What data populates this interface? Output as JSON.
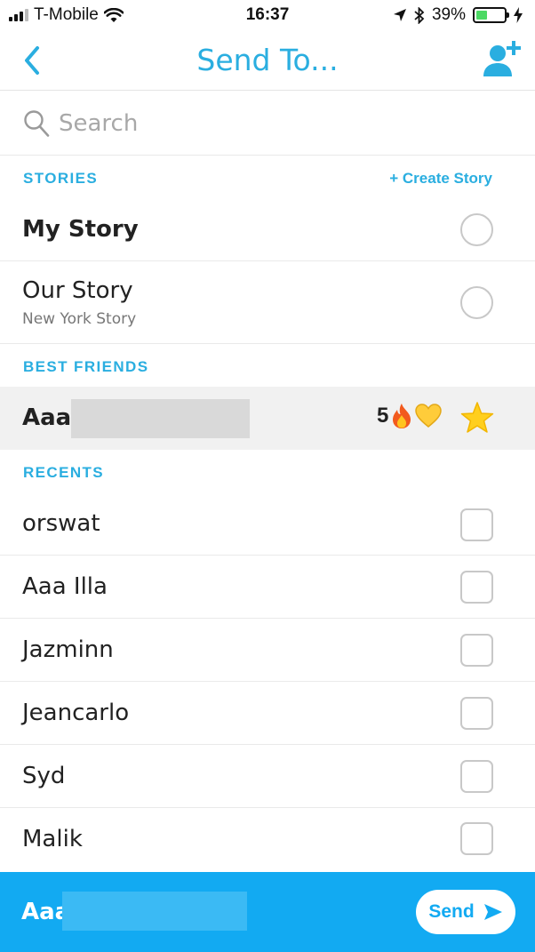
{
  "status": {
    "carrier": "T-Mobile",
    "time": "16:37",
    "battery": "39%",
    "battery_level": 0.39,
    "icons": [
      "signal-icon",
      "wifi-icon",
      "location-icon",
      "bluetooth-icon",
      "battery-icon",
      "charging-icon"
    ]
  },
  "nav": {
    "title": "Send To...",
    "back_icon": "chevron-left-icon",
    "add_icon": "add-friend-icon"
  },
  "search": {
    "placeholder": "Search"
  },
  "stories": {
    "header": "STORIES",
    "create_label": "+ Create Story",
    "items": [
      {
        "name": "My Story"
      },
      {
        "name": "Our Story",
        "sub": "New York Story"
      }
    ]
  },
  "best_friends": {
    "header": "BEST FRIENDS",
    "items": [
      {
        "name": "Aaa",
        "streak": "5",
        "emoji": [
          "fire-icon",
          "yellow-heart-icon"
        ],
        "star_icon": "star-icon"
      }
    ]
  },
  "recents": {
    "header": "RECENTS",
    "items": [
      {
        "name": "orswat"
      },
      {
        "name": "Aaa Illa"
      },
      {
        "name": "Jazminn"
      },
      {
        "name": "Jeancarlo"
      },
      {
        "name": "Syd"
      },
      {
        "name": "Malik"
      }
    ]
  },
  "send_bar": {
    "recipient": "Aaa",
    "send_label": "Send"
  },
  "colors": {
    "accent": "#2aaee0",
    "send_bar": "#12aaf2",
    "battery": "#4cd964"
  }
}
